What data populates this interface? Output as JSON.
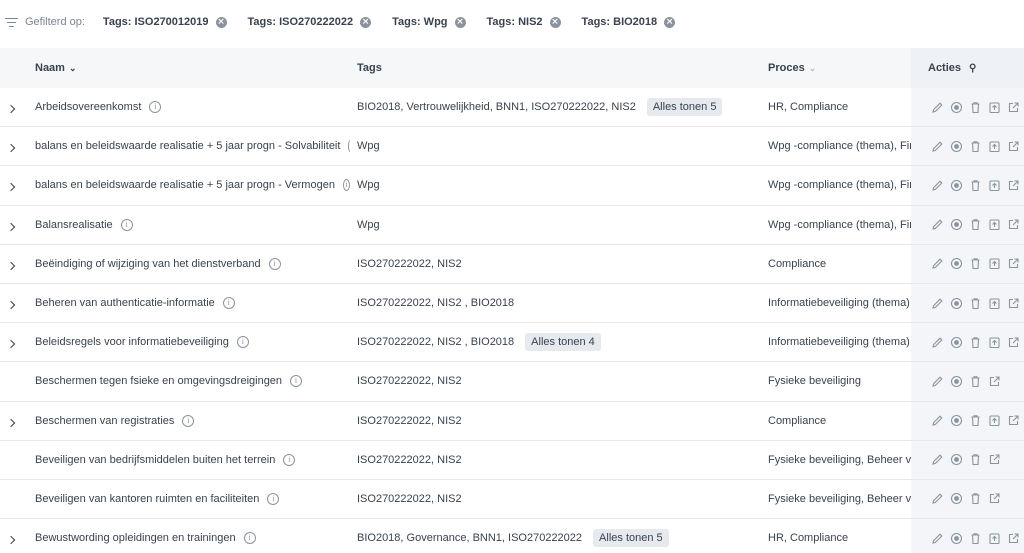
{
  "filter": {
    "label": "Gefilterd op:",
    "chips": [
      "Tags: ISO270012019",
      "Tags: ISO270222022",
      "Tags: Wpg",
      "Tags: NIS2",
      "Tags: BIO2018"
    ]
  },
  "table": {
    "columns": {
      "name": "Naam",
      "tags": "Tags",
      "proces": "Proces",
      "acties": "Acties"
    },
    "rows": [
      {
        "expandable": true,
        "name": "Arbeidsovereenkomst",
        "tags": "BIO2018, Vertrouwelijkheid, BNN1, ISO270222022,  NIS2",
        "show_all": "Alles tonen 5",
        "proces": "HR, Compliance",
        "upload": true
      },
      {
        "expandable": true,
        "name": "balans en beleidswaarde realisatie + 5 jaar progn - Solvabiliteit",
        "tags": "Wpg",
        "show_all": "",
        "proces": "Wpg -compliance (thema), Financ",
        "upload": true
      },
      {
        "expandable": true,
        "name": "balans en beleidswaarde realisatie + 5 jaar progn - Vermogen",
        "tags": "Wpg",
        "show_all": "",
        "proces": "Wpg -compliance (thema), Financ",
        "upload": true
      },
      {
        "expandable": true,
        "name": "Balansrealisatie",
        "tags": "Wpg",
        "show_all": "",
        "proces": "Wpg -compliance (thema), Financ",
        "upload": true
      },
      {
        "expandable": true,
        "name": "Beëindiging of wijziging van het dienstverband",
        "tags": "ISO270222022, NIS2",
        "show_all": "",
        "proces": "Compliance",
        "upload": true
      },
      {
        "expandable": true,
        "name": "Beheren van authenticatie-informatie",
        "tags": "ISO270222022, NIS2 , BIO2018",
        "show_all": "",
        "proces": "Informatiebeveiliging (thema)",
        "upload": true
      },
      {
        "expandable": true,
        "name": "Beleidsregels voor informatiebeveiliging",
        "tags": "ISO270222022, NIS2 , BIO2018",
        "show_all": "Alles tonen 4",
        "proces": "Informatiebeveiliging (thema), Co",
        "upload": true
      },
      {
        "expandable": false,
        "name": "Beschermen tegen fsieke en omgevingsdreigingen",
        "tags": "ISO270222022, NIS2",
        "show_all": "",
        "proces": "Fysieke beveiliging",
        "upload": false
      },
      {
        "expandable": true,
        "name": "Beschermen van registraties",
        "tags": "ISO270222022, NIS2",
        "show_all": "",
        "proces": "Compliance",
        "upload": true
      },
      {
        "expandable": false,
        "name": "Beveiligen van bedrijfsmiddelen buiten het terrein",
        "tags": "ISO270222022, NIS2",
        "show_all": "",
        "proces": "Fysieke beveiliging, Beheer van be",
        "upload": false
      },
      {
        "expandable": false,
        "name": "Beveiligen van kantoren ruimten en faciliteiten",
        "tags": "ISO270222022, NIS2",
        "show_all": "",
        "proces": "Fysieke beveiliging, Beheer van be",
        "upload": false
      },
      {
        "expandable": true,
        "name": "Bewustwording opleidingen en trainingen",
        "tags": "BIO2018, Governance, BNN1, ISO270222022",
        "show_all": "Alles tonen 5",
        "proces": "HR, Compliance",
        "upload": true
      }
    ]
  },
  "icons": {
    "filter": "filter-icon",
    "chip_remove": "close-circle-icon",
    "sort_down": "chevron-down-icon",
    "pin": "pin-icon",
    "expand": "chevron-right-icon",
    "info": "info-icon",
    "actions": [
      "edit-icon",
      "target-icon",
      "trash-icon",
      "upload-icon",
      "external-link-icon"
    ]
  },
  "colors": {
    "header_bg": "#f5f7f9",
    "actions_bg": "#f3f5f8",
    "muted_text": "#7a8593",
    "badge_bg": "#e6e9ed"
  }
}
